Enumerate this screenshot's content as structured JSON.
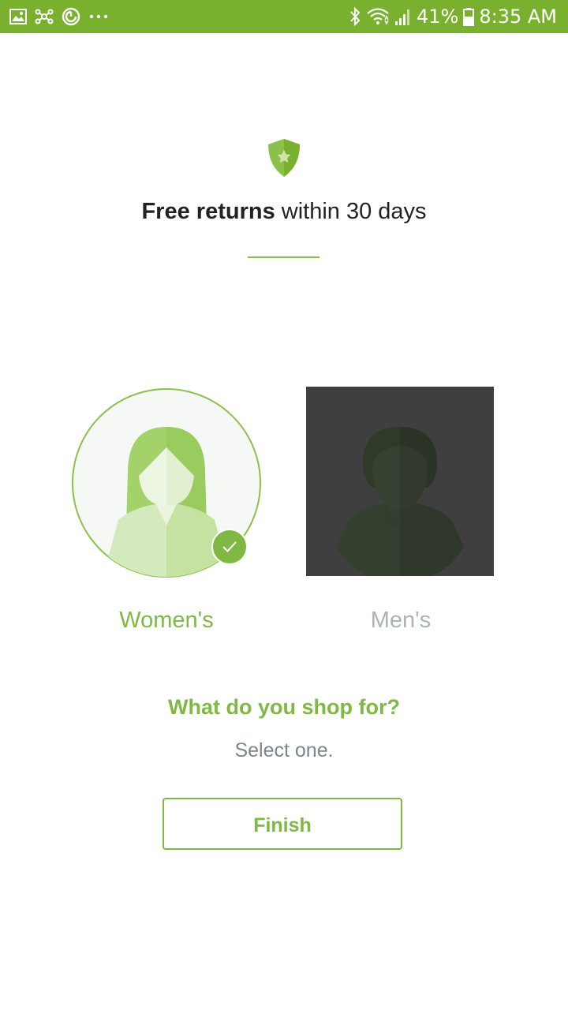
{
  "status_bar": {
    "battery": "41%",
    "time": "8:35 AM",
    "left_icons": [
      "gallery-icon",
      "network-icon",
      "sync-icon",
      "more-icon"
    ],
    "right_icons": [
      "bluetooth-icon",
      "wifi-icon",
      "signal-icon",
      "battery-icon"
    ],
    "background_color": "#79b12f"
  },
  "promo": {
    "bold_text": "Free returns",
    "rest_text": " within 30 days",
    "icon": "shield-star-icon"
  },
  "options": {
    "women": {
      "label": "Women's",
      "selected": true
    },
    "men": {
      "label": "Men's",
      "selected": false
    }
  },
  "prompt": {
    "question": "What do you shop for?",
    "instruction": "Select one."
  },
  "finish_button": {
    "label": "Finish"
  },
  "colors": {
    "accent": "#7fb843",
    "muted_text": "#7c868b",
    "unselected_label": "#a9b4b8"
  }
}
